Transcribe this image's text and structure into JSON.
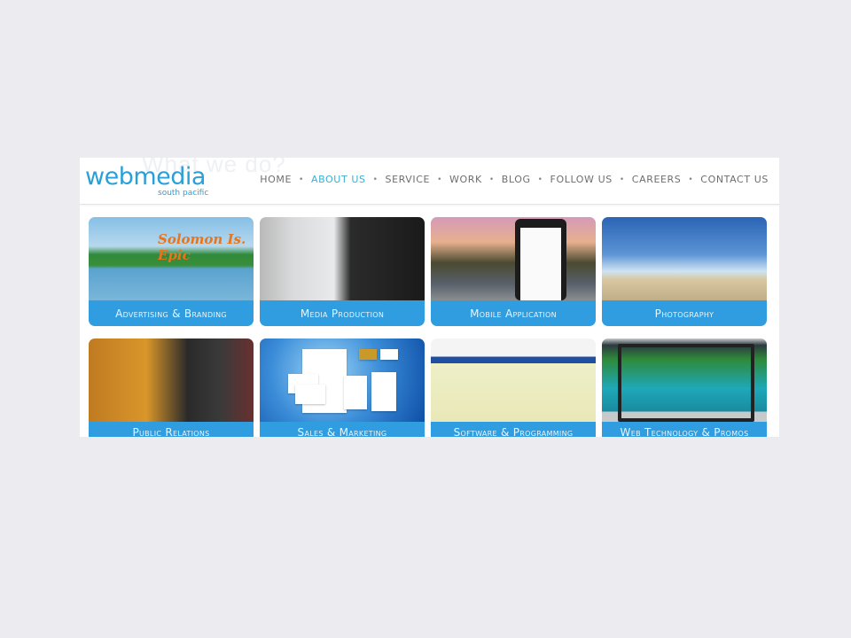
{
  "header": {
    "ghost_heading": "What we do?",
    "logo": {
      "main": "webmedia",
      "sub": "south pacific"
    },
    "nav": [
      {
        "label": "HOME",
        "active": false
      },
      {
        "label": "ABOUT US",
        "active": true
      },
      {
        "label": "SERVICE",
        "active": false
      },
      {
        "label": "WORK",
        "active": false
      },
      {
        "label": "BLOG",
        "active": false
      },
      {
        "label": "FOLLOW US",
        "active": false
      },
      {
        "label": "CAREERS",
        "active": false
      },
      {
        "label": "CONTACT US",
        "active": false
      }
    ],
    "separator": "•"
  },
  "services": [
    {
      "label": "Advertising & Branding",
      "image_caption": "Solomon Is. Epic"
    },
    {
      "label": "Media Production"
    },
    {
      "label": "Mobile Application"
    },
    {
      "label": "Photography"
    },
    {
      "label": "Public Relations"
    },
    {
      "label": "Sales & Marketing"
    },
    {
      "label": "Software & Programming"
    },
    {
      "label": "Web Technology & Promos"
    }
  ],
  "colors": {
    "brand_blue": "#2a9fd8",
    "label_bar": "#2f9de0",
    "nav_active": "#3ab0d6",
    "nav_text": "#6e6e6e",
    "page_background": "#ebebf0"
  }
}
